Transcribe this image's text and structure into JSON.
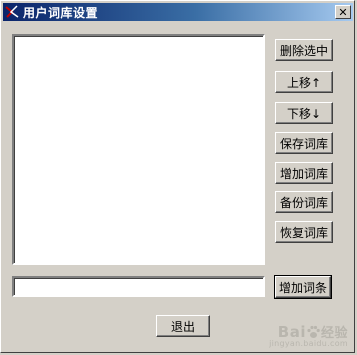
{
  "window": {
    "title": "用户词库设置",
    "close_label": "✕"
  },
  "buttons": {
    "delete_selected": "删除选中",
    "move_up": "上移↑",
    "move_down": "下移↓",
    "save_lexicon": "保存词库",
    "add_lexicon": "增加词库",
    "backup_lexicon": "备份词库",
    "restore_lexicon": "恢复词库",
    "add_entry": "增加词条",
    "exit": "退出"
  },
  "entry_input": {
    "value": "",
    "placeholder": ""
  },
  "watermark": {
    "logo": "Bai",
    "logo_cn": "经验",
    "url": "jingyan.baidu.com"
  },
  "colors": {
    "titlebar_start": "#0a246a",
    "titlebar_end": "#a6caf0",
    "face": "#d4d0c8"
  },
  "icons": {
    "app": "app-icon",
    "close": "close-icon",
    "paw": "paw-icon"
  }
}
